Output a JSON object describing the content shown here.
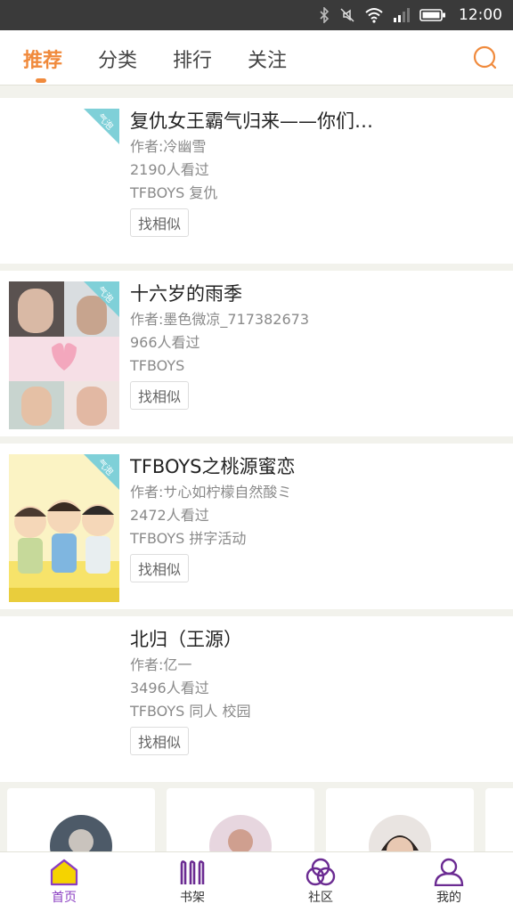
{
  "status_bar": {
    "time": "12:00"
  },
  "top_nav": {
    "tabs": [
      {
        "label": "推荐",
        "active": true
      },
      {
        "label": "分类",
        "active": false
      },
      {
        "label": "排行",
        "active": false
      },
      {
        "label": "关注",
        "active": false
      }
    ],
    "search_icon": "search-icon",
    "accent_color": "#f08a3c"
  },
  "feed": {
    "items": [
      {
        "title": "复仇女王霸气归来——你们…",
        "author": "作者:冷幽雪",
        "views": "2190人看过",
        "tags": "TFBOYS 复仇",
        "similar_label": "找相似",
        "ribbon": "气泡"
      },
      {
        "title": "十六岁的雨季",
        "author": "作者:墨色微凉_717382673",
        "views": "966人看过",
        "tags": "TFBOYS",
        "similar_label": "找相似",
        "ribbon": "气泡"
      },
      {
        "title": "TFBOYS之桃源蜜恋",
        "author": "作者:サ心如柠檬自然酸ミ",
        "views": "2472人看过",
        "tags": "TFBOYS 拼字活动",
        "similar_label": "找相似",
        "ribbon": "气泡"
      },
      {
        "title": "北归（王源）",
        "author": "作者:亿一",
        "views": "3496人看过",
        "tags": "TFBOYS 同人 校园",
        "similar_label": "找相似"
      }
    ]
  },
  "bottom_nav": {
    "items": [
      {
        "label": "首页",
        "icon": "home-icon",
        "active": true
      },
      {
        "label": "书架",
        "icon": "bookshelf-icon",
        "active": false
      },
      {
        "label": "社区",
        "icon": "community-icon",
        "active": false
      },
      {
        "label": "我的",
        "icon": "profile-icon",
        "active": false
      }
    ],
    "active_color": "#8b3fc2"
  }
}
